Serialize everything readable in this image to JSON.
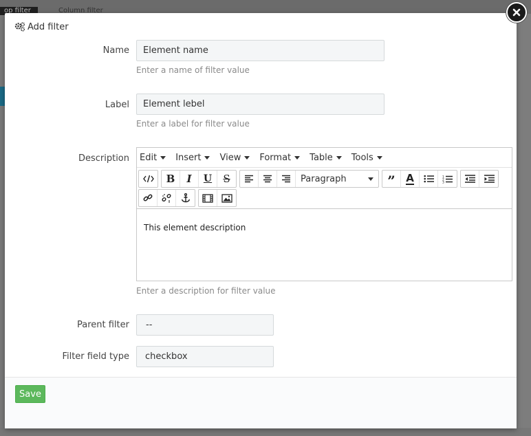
{
  "background": {
    "tab_active": "op filter",
    "tab_inactive": "Column filter"
  },
  "modal": {
    "title": "Add filter",
    "title_icon": "gears-icon",
    "close_icon": "close-icon"
  },
  "form": {
    "name": {
      "label": "Name",
      "value": "Element name",
      "help": "Enter a name of filter value"
    },
    "label_field": {
      "label": "Label",
      "value": "Element lebel",
      "help": "Enter a label for filter value"
    },
    "description": {
      "label": "Description",
      "content": "This element description",
      "help": "Enter a description for filter value"
    },
    "parent_filter": {
      "label": "Parent filter",
      "value": "--"
    },
    "filter_field_type": {
      "label": "Filter field type",
      "value": "checkbox"
    }
  },
  "editor": {
    "menus": [
      "Edit",
      "Insert",
      "View",
      "Format",
      "Table",
      "Tools"
    ],
    "format_select": "Paragraph",
    "toolbar_icons": [
      "code-icon",
      "bold-icon",
      "italic-icon",
      "underline-icon",
      "strikethrough-icon",
      "align-left-icon",
      "align-center-icon",
      "align-right-icon",
      "blockquote-icon",
      "text-color-icon",
      "bullet-list-icon",
      "numbered-list-icon",
      "outdent-icon",
      "indent-icon",
      "link-icon",
      "unlink-icon",
      "anchor-icon",
      "media-icon",
      "image-icon"
    ]
  },
  "footer": {
    "save_label": "Save"
  },
  "colors": {
    "save_button": "#5cb85c",
    "input_bg": "#f4f6f7",
    "background_accent": "#1b6a86"
  }
}
